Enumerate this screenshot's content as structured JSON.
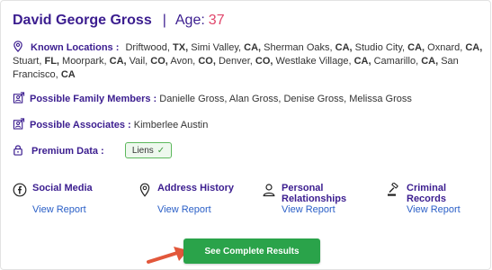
{
  "header": {
    "name": "David George Gross",
    "separator": "|",
    "age_label": "Age:",
    "age_value": "37"
  },
  "locations": {
    "label": "Known Locations :",
    "items": [
      {
        "city": "Driftwood,",
        "state": "TX,"
      },
      {
        "city": "Simi Valley,",
        "state": "CA,"
      },
      {
        "city": "Sherman Oaks,",
        "state": "CA,"
      },
      {
        "city": "Studio City,",
        "state": "CA,"
      },
      {
        "city": "Oxnard,",
        "state": "CA,"
      },
      {
        "city": "Stuart,",
        "state": "FL,"
      },
      {
        "city": "Moorpark,",
        "state": "CA,"
      },
      {
        "city": "Vail,",
        "state": "CO,"
      },
      {
        "city": "Avon,",
        "state": "CO,"
      },
      {
        "city": "Denver,",
        "state": "CO,"
      },
      {
        "city": "Westlake Village,",
        "state": "CA,"
      },
      {
        "city": "Camarillo,",
        "state": "CA,"
      },
      {
        "city": "San Francisco,",
        "state": "CA"
      }
    ]
  },
  "family": {
    "label": "Possible Family Members :",
    "value": "Danielle Gross, Alan Gross, Denise Gross, Melissa Gross"
  },
  "associates": {
    "label": "Possible Associates :",
    "value": "Kimberlee Austin"
  },
  "premium": {
    "label": "Premium Data :",
    "badge": "Liens",
    "badge_check": "✓"
  },
  "reports": [
    {
      "title": "Social Media",
      "link": "View Report",
      "icon": "facebook-icon"
    },
    {
      "title": "Address History",
      "link": "View Report",
      "icon": "location-pin-icon"
    },
    {
      "title": "Personal Relationships",
      "link": "View Report",
      "icon": "person-icon"
    },
    {
      "title": "Criminal Records",
      "link": "View Report",
      "icon": "gavel-icon"
    }
  ],
  "cta": {
    "label": "See Complete Results"
  },
  "colors": {
    "accent": "#3b1d8f",
    "age": "#e0466b",
    "link": "#2a5fc7",
    "cta": "#2aa34a",
    "arrow": "#e2573b"
  }
}
